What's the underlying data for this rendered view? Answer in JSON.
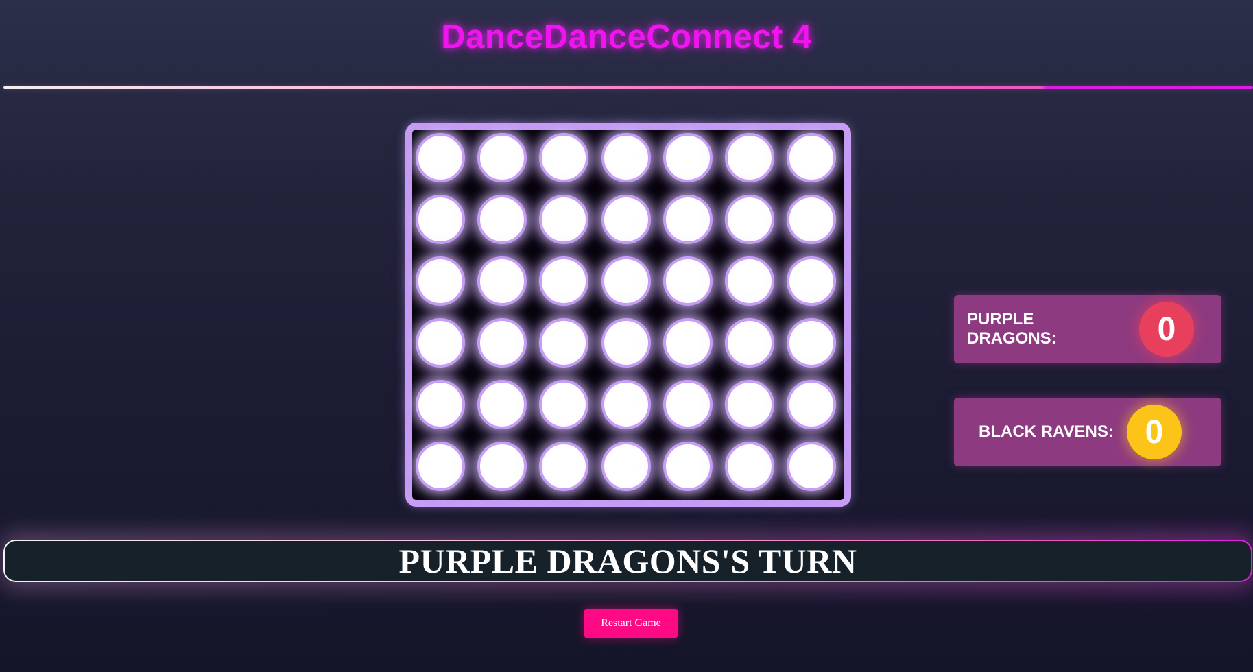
{
  "header": {
    "title": "DanceDanceConnect 4"
  },
  "board": {
    "rows": 6,
    "columns": 7,
    "cells": [
      [
        "empty",
        "empty",
        "empty",
        "empty",
        "empty",
        "empty",
        "empty"
      ],
      [
        "empty",
        "empty",
        "empty",
        "empty",
        "empty",
        "empty",
        "empty"
      ],
      [
        "empty",
        "empty",
        "empty",
        "empty",
        "empty",
        "empty",
        "empty"
      ],
      [
        "empty",
        "empty",
        "empty",
        "empty",
        "empty",
        "empty",
        "empty"
      ],
      [
        "empty",
        "empty",
        "empty",
        "empty",
        "empty",
        "empty",
        "empty"
      ],
      [
        "empty",
        "empty",
        "empty",
        "empty",
        "empty",
        "empty",
        "empty"
      ]
    ]
  },
  "scores": {
    "player1": {
      "label": "PURPLE DRAGONS:",
      "score": "0",
      "color": "#e8405c"
    },
    "player2": {
      "label": "BLACK RAVENS:",
      "score": "0",
      "color": "#fcc419"
    }
  },
  "status": {
    "turn_text": "PURPLE DRAGONS'S TURN"
  },
  "controls": {
    "restart_label": "Restart Game"
  },
  "colors": {
    "title": "#f014f0",
    "board_frame": "#c79ef5",
    "score_card": "#8e3a80",
    "restart_button": "#ff0a85"
  }
}
